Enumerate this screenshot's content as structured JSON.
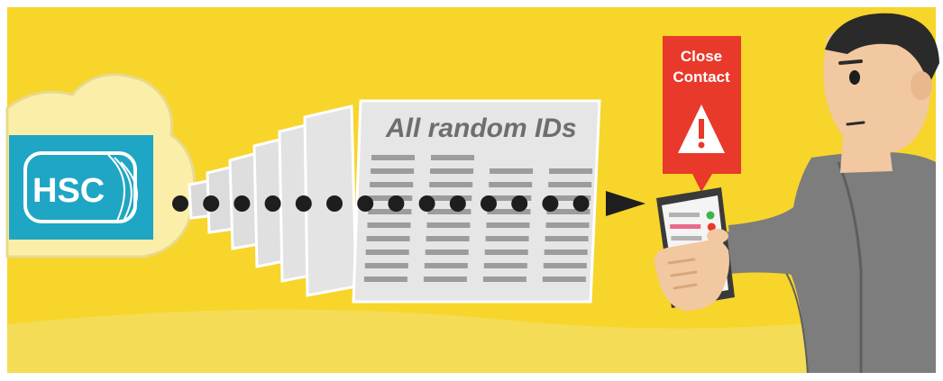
{
  "logo": {
    "text": "HSC",
    "colors": {
      "fill": "#1fa6c4",
      "text": "#ffffff"
    }
  },
  "document": {
    "title": "All random IDs"
  },
  "alert": {
    "line1": "Close",
    "line2": "Contact",
    "icon": "warning-triangle-icon",
    "color": "#e8392a"
  },
  "colors": {
    "background": "#f7d52a",
    "dots": "#1e1e1e",
    "paper": "#e6e6e6",
    "shirt": "#7d7d7d"
  }
}
